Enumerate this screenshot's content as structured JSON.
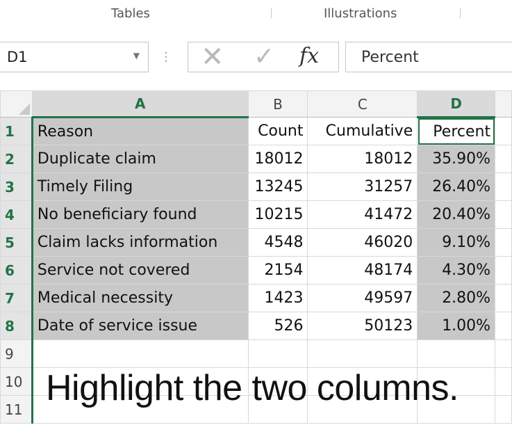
{
  "ribbon": {
    "groups": [
      "Tables",
      "Illustrations"
    ]
  },
  "formula_bar": {
    "name_box": "D1",
    "cancel_icon": "x-icon",
    "enter_icon": "check-icon",
    "function_label": "fx",
    "content": "Percent"
  },
  "columns": [
    "A",
    "B",
    "C",
    "D"
  ],
  "rows": [
    {
      "num": "1",
      "cells": [
        "Reason",
        "Count",
        "Cumulative",
        "Percent"
      ]
    },
    {
      "num": "2",
      "cells": [
        "Duplicate claim",
        "18012",
        "18012",
        "35.90%"
      ]
    },
    {
      "num": "3",
      "cells": [
        "Timely Filing",
        "13245",
        "31257",
        "26.40%"
      ]
    },
    {
      "num": "4",
      "cells": [
        "No beneficiary found",
        "10215",
        "41472",
        "20.40%"
      ]
    },
    {
      "num": "5",
      "cells": [
        "Claim lacks information",
        "4548",
        "46020",
        "9.10%"
      ]
    },
    {
      "num": "6",
      "cells": [
        "Service not covered",
        "2154",
        "48174",
        "4.30%"
      ]
    },
    {
      "num": "7",
      "cells": [
        "Medical necessity",
        "1423",
        "49597",
        "2.80%"
      ]
    },
    {
      "num": "8",
      "cells": [
        "Date of service issue",
        "526",
        "50123",
        "1.00%"
      ]
    },
    {
      "num": "9",
      "cells": [
        "",
        "",
        "",
        ""
      ]
    },
    {
      "num": "10",
      "cells": [
        "",
        "",
        "",
        ""
      ]
    },
    {
      "num": "11",
      "cells": [
        "",
        "",
        "",
        ""
      ]
    }
  ],
  "caption": "Highlight the two columns.",
  "colors": {
    "accent": "#217346",
    "selection": "#c8c8c8"
  }
}
